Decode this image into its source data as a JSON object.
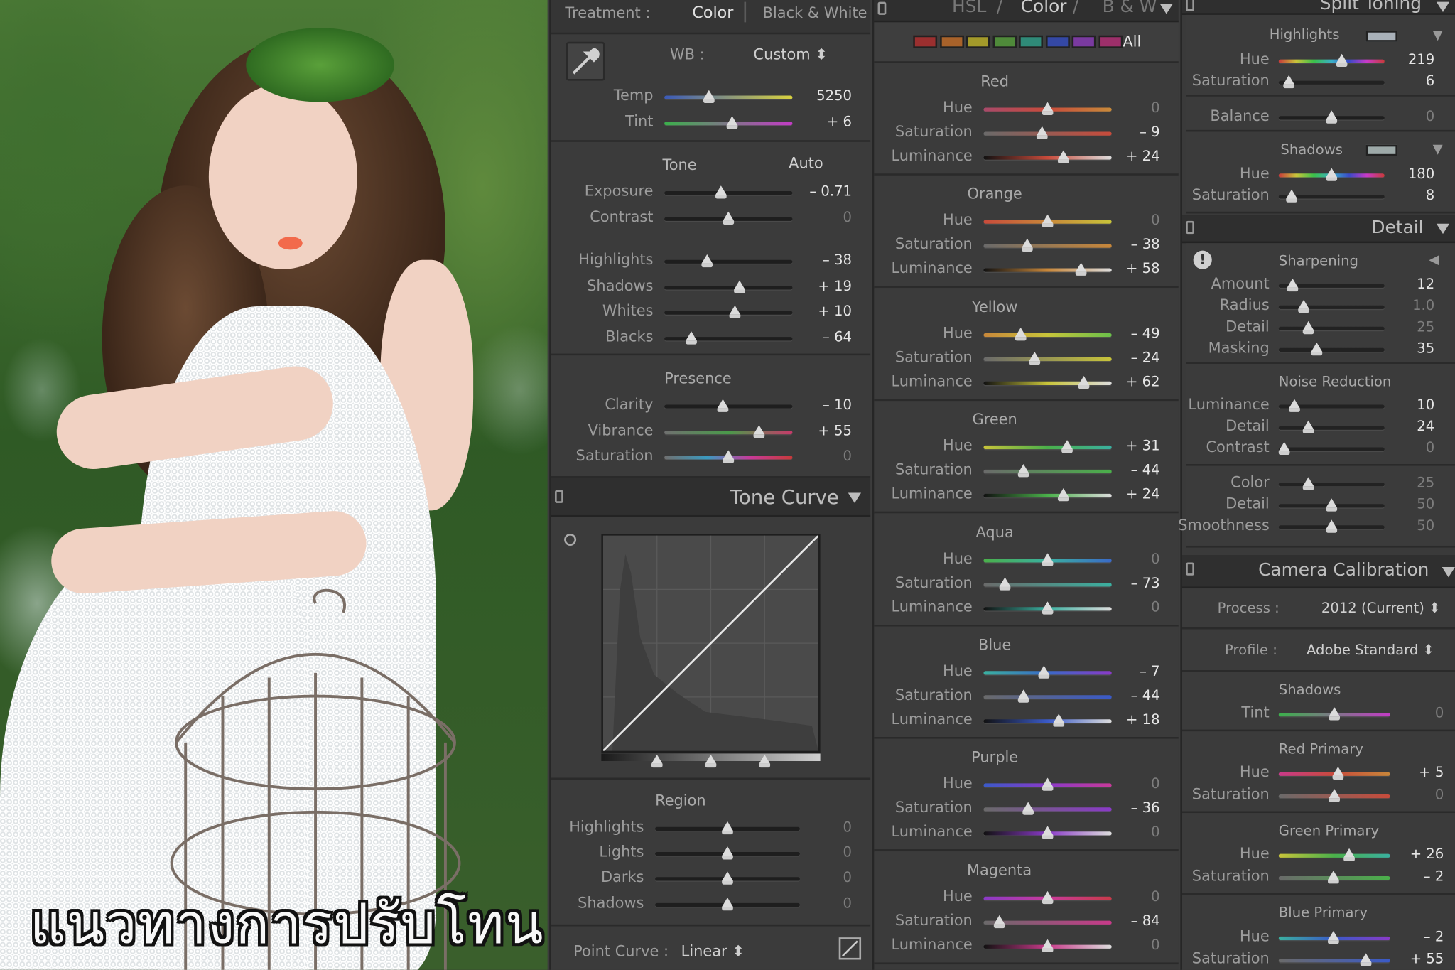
{
  "caption": "แนวทางการปรับโทน",
  "basic": {
    "treatment_label": "Treatment :",
    "treatment_color": "Color",
    "treatment_bw": "Black & White",
    "wb_label": "WB :",
    "wb_value": "Custom",
    "temp": {
      "label": "Temp",
      "value": "5250",
      "pos": 0.35
    },
    "tint": {
      "label": "Tint",
      "value": "+ 6",
      "pos": 0.53
    },
    "tone_label": "Tone",
    "auto_label": "Auto",
    "exposure": {
      "label": "Exposure",
      "value": "– 0.71",
      "pos": 0.44
    },
    "contrast": {
      "label": "Contrast",
      "value": "0",
      "pos": 0.5
    },
    "highlights": {
      "label": "Highlights",
      "value": "– 38",
      "pos": 0.33
    },
    "shadows": {
      "label": "Shadows",
      "value": "+ 19",
      "pos": 0.59
    },
    "whites": {
      "label": "Whites",
      "value": "+ 10",
      "pos": 0.55
    },
    "blacks": {
      "label": "Blacks",
      "value": "– 64",
      "pos": 0.21
    },
    "presence_label": "Presence",
    "clarity": {
      "label": "Clarity",
      "value": "– 10",
      "pos": 0.46
    },
    "vibrance": {
      "label": "Vibrance",
      "value": "+ 55",
      "pos": 0.74
    },
    "saturation": {
      "label": "Saturation",
      "value": "0",
      "pos": 0.5
    }
  },
  "tone_curve": {
    "title": "Tone Curve",
    "region_label": "Region",
    "highlights": {
      "label": "Highlights",
      "value": "0",
      "pos": 0.5
    },
    "lights": {
      "label": "Lights",
      "value": "0",
      "pos": 0.5
    },
    "darks": {
      "label": "Darks",
      "value": "0",
      "pos": 0.5
    },
    "shadows": {
      "label": "Shadows",
      "value": "0",
      "pos": 0.5
    },
    "point_curve_label": "Point Curve :",
    "point_curve_value": "Linear"
  },
  "hsl": {
    "tab_hsl": "HSL",
    "tab_color": "Color",
    "tab_bw": "B & W",
    "all_label": "All",
    "swatch_colors": [
      "#9b2f2f",
      "#a8622a",
      "#a39a2a",
      "#4f8a3a",
      "#2f8a78",
      "#3448a5",
      "#7a3aa0",
      "#9d2f6a"
    ],
    "groups": [
      {
        "name": "Red",
        "rows": [
          {
            "label": "Hue",
            "value": "0",
            "pos": 0.5
          },
          {
            "label": "Saturation",
            "value": "– 9",
            "pos": 0.46
          },
          {
            "label": "Luminance",
            "value": "+ 24",
            "pos": 0.62
          }
        ]
      },
      {
        "name": "Orange",
        "rows": [
          {
            "label": "Hue",
            "value": "0",
            "pos": 0.5
          },
          {
            "label": "Saturation",
            "value": "– 38",
            "pos": 0.34
          },
          {
            "label": "Luminance",
            "value": "+ 58",
            "pos": 0.76
          }
        ]
      },
      {
        "name": "Yellow",
        "rows": [
          {
            "label": "Hue",
            "value": "– 49",
            "pos": 0.29
          },
          {
            "label": "Saturation",
            "value": "– 24",
            "pos": 0.4
          },
          {
            "label": "Luminance",
            "value": "+ 62",
            "pos": 0.78
          }
        ]
      },
      {
        "name": "Green",
        "rows": [
          {
            "label": "Hue",
            "value": "+ 31",
            "pos": 0.65
          },
          {
            "label": "Saturation",
            "value": "– 44",
            "pos": 0.31
          },
          {
            "label": "Luminance",
            "value": "+ 24",
            "pos": 0.62
          }
        ]
      },
      {
        "name": "Aqua",
        "rows": [
          {
            "label": "Hue",
            "value": "0",
            "pos": 0.5
          },
          {
            "label": "Saturation",
            "value": "– 73",
            "pos": 0.17
          },
          {
            "label": "Luminance",
            "value": "0",
            "pos": 0.5
          }
        ]
      },
      {
        "name": "Blue",
        "rows": [
          {
            "label": "Hue",
            "value": "– 7",
            "pos": 0.47
          },
          {
            "label": "Saturation",
            "value": "– 44",
            "pos": 0.31
          },
          {
            "label": "Luminance",
            "value": "+ 18",
            "pos": 0.59
          }
        ]
      },
      {
        "name": "Purple",
        "rows": [
          {
            "label": "Hue",
            "value": "0",
            "pos": 0.5
          },
          {
            "label": "Saturation",
            "value": "– 36",
            "pos": 0.35
          },
          {
            "label": "Luminance",
            "value": "0",
            "pos": 0.5
          }
        ]
      },
      {
        "name": "Magenta",
        "rows": [
          {
            "label": "Hue",
            "value": "0",
            "pos": 0.5
          },
          {
            "label": "Saturation",
            "value": "– 84",
            "pos": 0.12
          },
          {
            "label": "Luminance",
            "value": "0",
            "pos": 0.5
          }
        ]
      }
    ]
  },
  "split_toning": {
    "title": "Split Toning",
    "highlights_label": "Highlights",
    "highlights_color": "#a9b1b9",
    "hl_hue": {
      "label": "Hue",
      "value": "219",
      "pos": 0.6
    },
    "hl_sat": {
      "label": "Saturation",
      "value": "6",
      "pos": 0.1
    },
    "balance": {
      "label": "Balance",
      "value": "0",
      "pos": 0.5
    },
    "shadows_label": "Shadows",
    "shadows_color": "#9eaaa9",
    "sh_hue": {
      "label": "Hue",
      "value": "180",
      "pos": 0.5
    },
    "sh_sat": {
      "label": "Saturation",
      "value": "8",
      "pos": 0.12
    }
  },
  "detail": {
    "title": "Detail",
    "sharpening_label": "Sharpening",
    "amount": {
      "label": "Amount",
      "value": "12",
      "pos": 0.13
    },
    "radius": {
      "label": "Radius",
      "value": "1.0",
      "pos": 0.24
    },
    "detail": {
      "label": "Detail",
      "value": "25",
      "pos": 0.28
    },
    "masking": {
      "label": "Masking",
      "value": "35",
      "pos": 0.36
    },
    "noise_label": "Noise Reduction",
    "nr_luminance": {
      "label": "Luminance",
      "value": "10",
      "pos": 0.15
    },
    "nr_detail": {
      "label": "Detail",
      "value": "24",
      "pos": 0.28
    },
    "nr_contrast": {
      "label": "Contrast",
      "value": "0",
      "pos": 0.05
    },
    "color": {
      "label": "Color",
      "value": "25",
      "pos": 0.28
    },
    "color_detail": {
      "label": "Detail",
      "value": "50",
      "pos": 0.5
    },
    "smoothness": {
      "label": "Smoothness",
      "value": "50",
      "pos": 0.5
    }
  },
  "calibration": {
    "title": "Camera Calibration",
    "process_label": "Process :",
    "process_value": "2012 (Current)",
    "profile_label": "Profile :",
    "profile_value": "Adobe Standard",
    "shadows_label": "Shadows",
    "tint": {
      "label": "Tint",
      "value": "0",
      "pos": 0.5
    },
    "red_label": "Red Primary",
    "red_hue": {
      "label": "Hue",
      "value": "+ 5",
      "pos": 0.53
    },
    "red_sat": {
      "label": "Saturation",
      "value": "0",
      "pos": 0.5
    },
    "green_label": "Green Primary",
    "green_hue": {
      "label": "Hue",
      "value": "+ 26",
      "pos": 0.63
    },
    "green_sat": {
      "label": "Saturation",
      "value": "– 2",
      "pos": 0.49
    },
    "blue_label": "Blue Primary",
    "blue_hue": {
      "label": "Hue",
      "value": "– 2",
      "pos": 0.49
    },
    "blue_sat": {
      "label": "Saturation",
      "value": "+ 55",
      "pos": 0.78
    }
  }
}
